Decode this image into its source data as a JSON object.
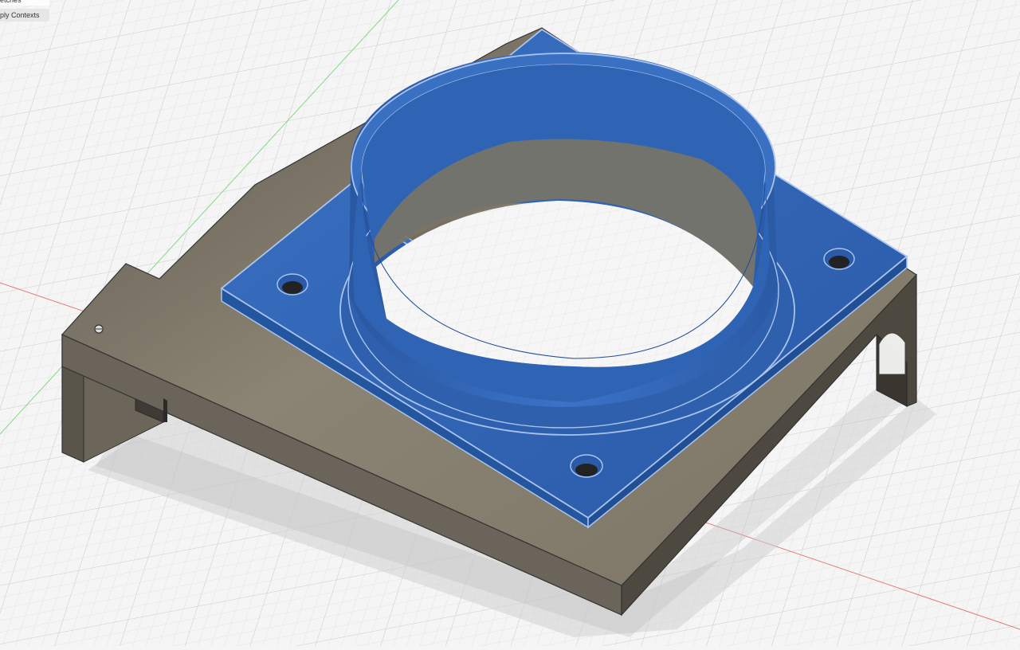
{
  "browser": {
    "items": [
      {
        "label": "etches"
      },
      {
        "label": "ply Contexts"
      }
    ]
  },
  "colors": {
    "background": "#f5f5f5",
    "grid_minor": "#e4e4e4",
    "grid_major": "#cfcfcf",
    "axis_x": "#e07070",
    "axis_y": "#7ad67a",
    "body_top": "#87806f",
    "body_side": "#5d574c",
    "selected_face": "#2f63b4",
    "selected_edge": "#aac4ee"
  },
  "icons": {
    "origin": "origin-icon"
  }
}
